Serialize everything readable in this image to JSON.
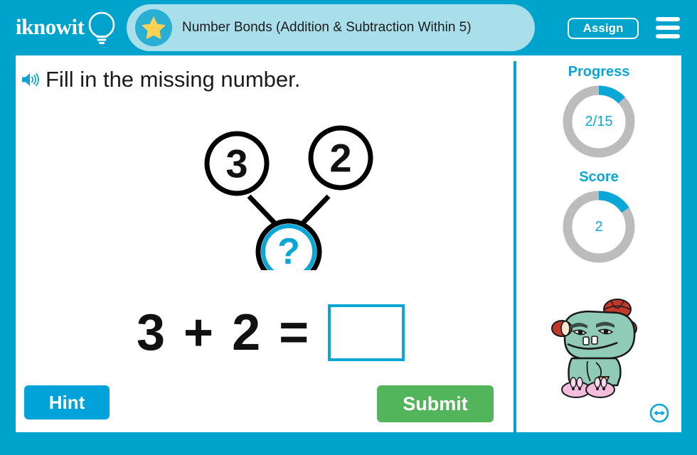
{
  "brand": {
    "logo_text": "iknowit",
    "logo_icon": "lightbulb-icon",
    "accent_color": "#00a3cc",
    "pill_color": "#a9dfeb"
  },
  "header": {
    "star_icon": "star-icon",
    "title": "Number Bonds (Addition & Subtraction Within 5)",
    "assign_label": "Assign",
    "menu_icon": "hamburger-menu-icon"
  },
  "question": {
    "audio_icon": "speaker-icon",
    "instruction": "Fill in the missing number.",
    "number_bond": {
      "left_part": "3",
      "right_part": "2",
      "whole": "?",
      "whole_is_unknown": true
    },
    "equation": {
      "text": "3 + 2 =",
      "left_operand": "3",
      "operator": "+",
      "right_operand": "2",
      "equals": "=",
      "answer_value": "",
      "answer_placeholder": ""
    }
  },
  "actions": {
    "hint_label": "Hint",
    "submit_label": "Submit",
    "hint_color": "#00a3d9",
    "submit_color": "#52b45b"
  },
  "sidebar": {
    "progress": {
      "label": "Progress",
      "value_text": "2/15",
      "current": 2,
      "total": 15,
      "percent": 13,
      "arc_color": "#0aa6d6",
      "track_color": "#bcbcbc"
    },
    "score": {
      "label": "Score",
      "value_text": "2",
      "current": 2,
      "percent": 16,
      "arc_color": "#0aa6d6",
      "track_color": "#bcbcbc"
    },
    "mascot": "monster-mascot",
    "resize_icon": "resize-horizontal-icon"
  }
}
